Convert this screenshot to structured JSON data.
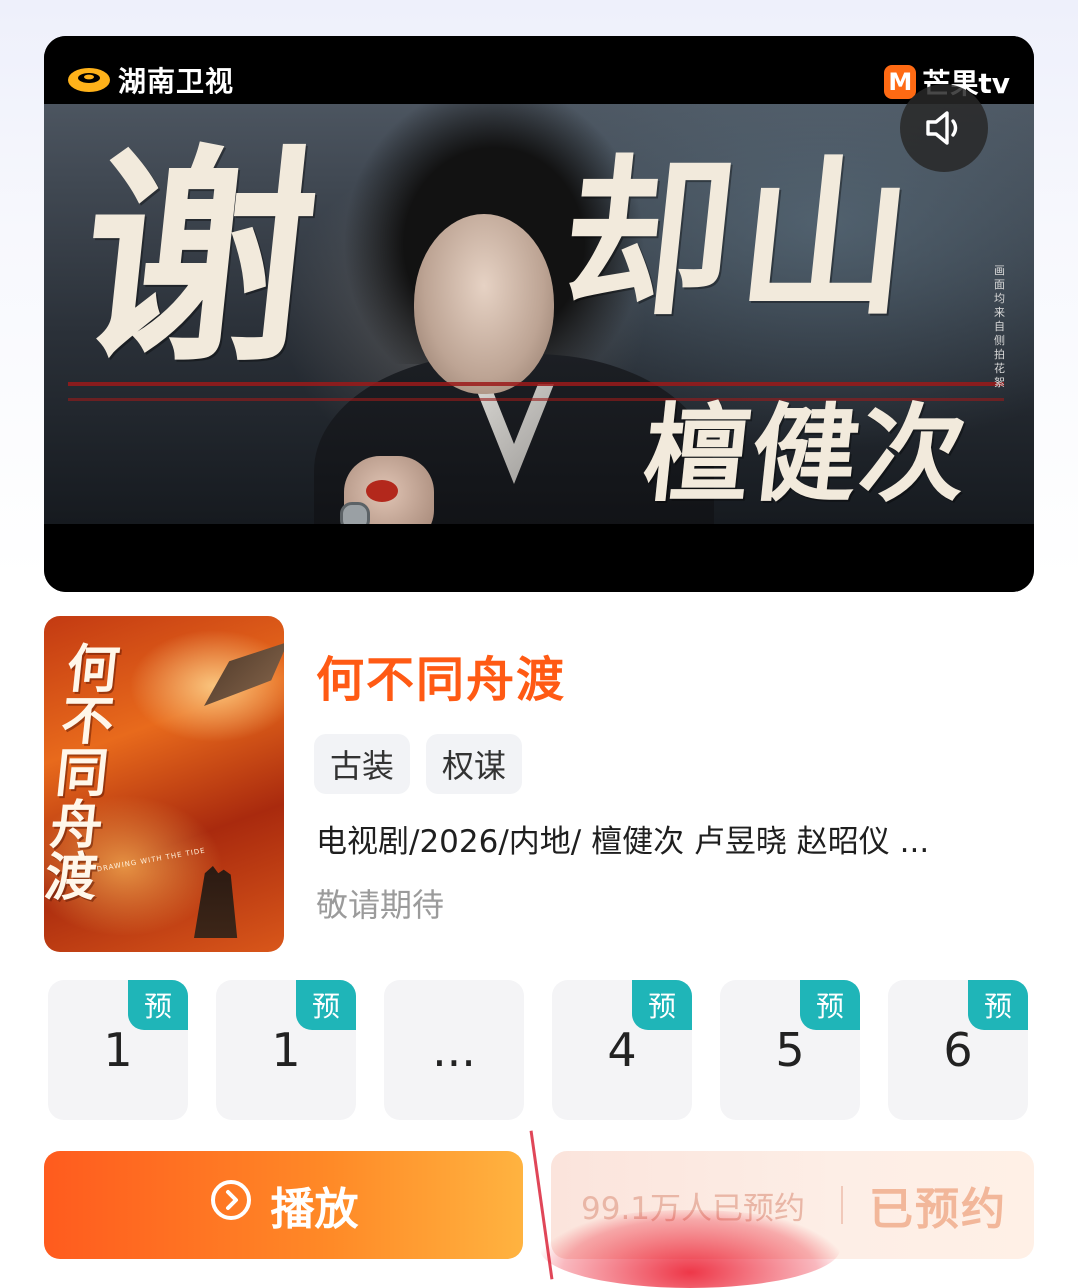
{
  "video": {
    "channel_logo": "湖南卫视",
    "platform_logo": "芒果tv",
    "platform_logo_mark": "M",
    "overlay_name": "谢却山",
    "overlay_name_first": "谢",
    "overlay_name_rest": "却山",
    "overlay_actor": "檀健次",
    "side_note": "画面均来自侧拍花絮",
    "sound_icon": "speaker-icon"
  },
  "show": {
    "poster_title": "何不同舟渡",
    "poster_subtitle": "DRAWING WITH THE TIDE",
    "title": "何不同舟渡",
    "tags": [
      "古装",
      "权谋"
    ],
    "meta": "电视剧/2026/内地/ 檀健次 卢昱晓 赵昭仪 ...",
    "status": "敬请期待"
  },
  "episodes": [
    {
      "label": "1",
      "badge": "预"
    },
    {
      "label": "1",
      "badge": "预"
    },
    {
      "label": "...",
      "badge": ""
    },
    {
      "label": "4",
      "badge": "预"
    },
    {
      "label": "5",
      "badge": "预"
    },
    {
      "label": "6",
      "badge": "预"
    }
  ],
  "actions": {
    "play_label": "播放",
    "reserve_count": "99.1万人已预约",
    "reserve_label": "已预约"
  },
  "colors": {
    "accent_orange": "#ff5a14",
    "badge_teal": "#1fb5b8"
  }
}
